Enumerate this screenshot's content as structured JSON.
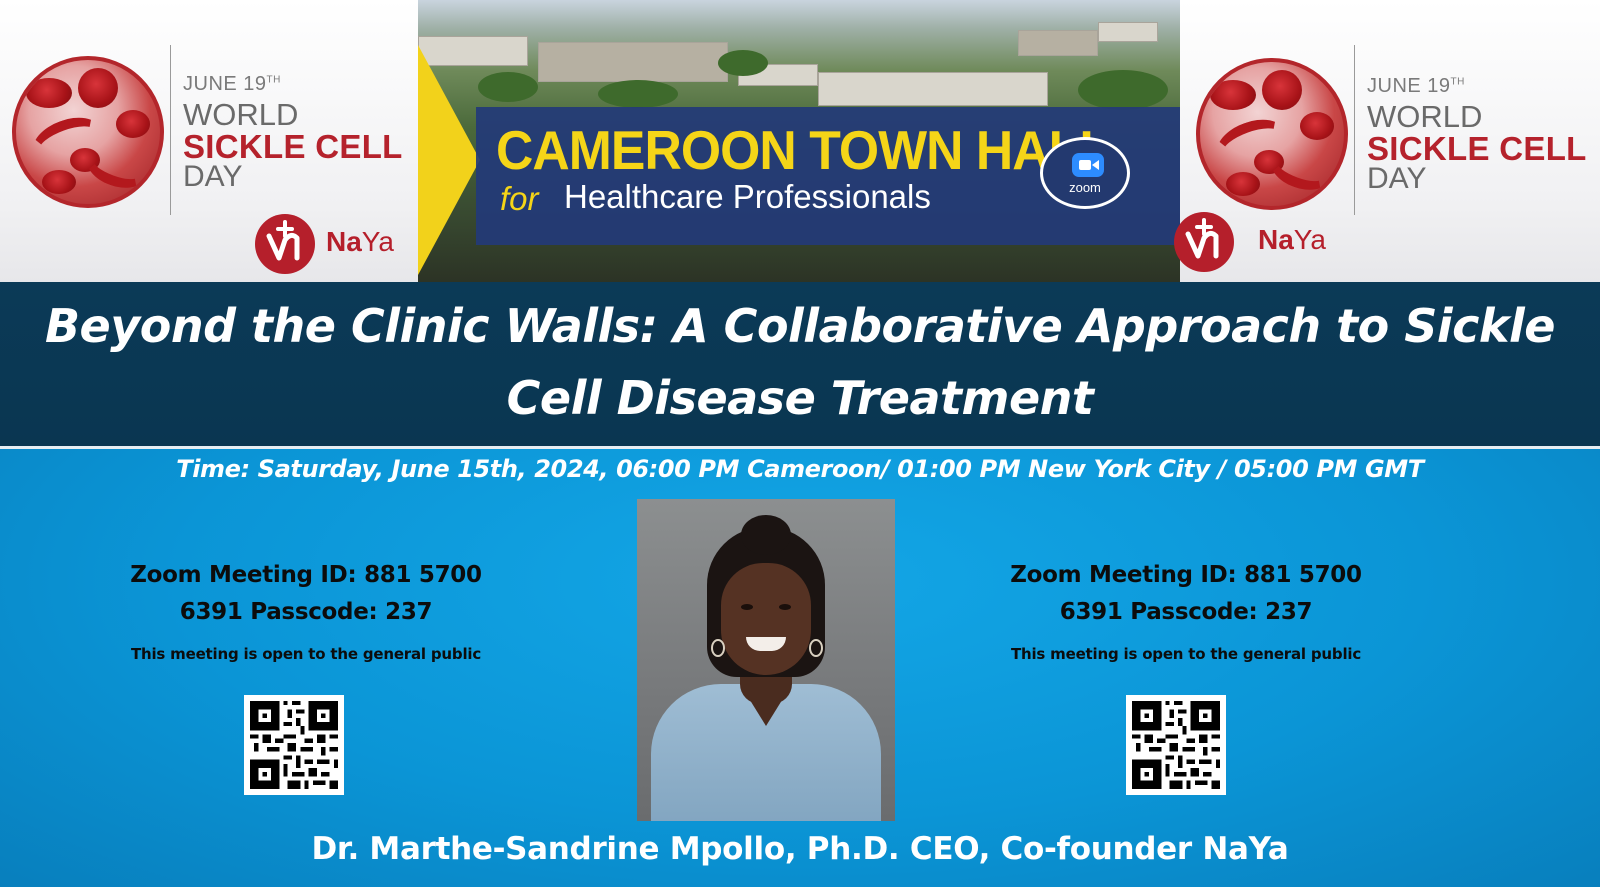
{
  "world_sickle_cell_badge": {
    "date": "JUNE 19",
    "date_suffix": "TH",
    "line1": "WORLD",
    "line2": "SICKLE CELL",
    "line3": "DAY",
    "logo_na": "Na",
    "logo_ya": "Ya"
  },
  "banner": {
    "title": "CAMEROON TOWN HALL",
    "for": "for",
    "subtitle": "Healthcare Professionals",
    "zoom_label": "zoom"
  },
  "headline": "Beyond the Clinic Walls: A Collaborative Approach to Sickle Cell Disease Treatment",
  "time": "Time: Saturday, June 15th, 2024, 06:00 PM Cameroon/ 01:00 PM New York  City / 05:00 PM GMT",
  "zoom_info": {
    "meeting_line1": "Zoom Meeting ID: 881 5700",
    "meeting_line2": "6391  Passcode: 237",
    "public_note": "This meeting is open to the general public"
  },
  "speaker": "Dr. Marthe-Sandrine Mpollo, Ph.D. CEO, Co-founder NaYa",
  "colors": {
    "brand_red": "#b51f2b",
    "banner_yellow": "#f5d518",
    "banner_blue": "#233978",
    "title_band": "#0b3a57",
    "info_blue": "#0b95d6"
  }
}
